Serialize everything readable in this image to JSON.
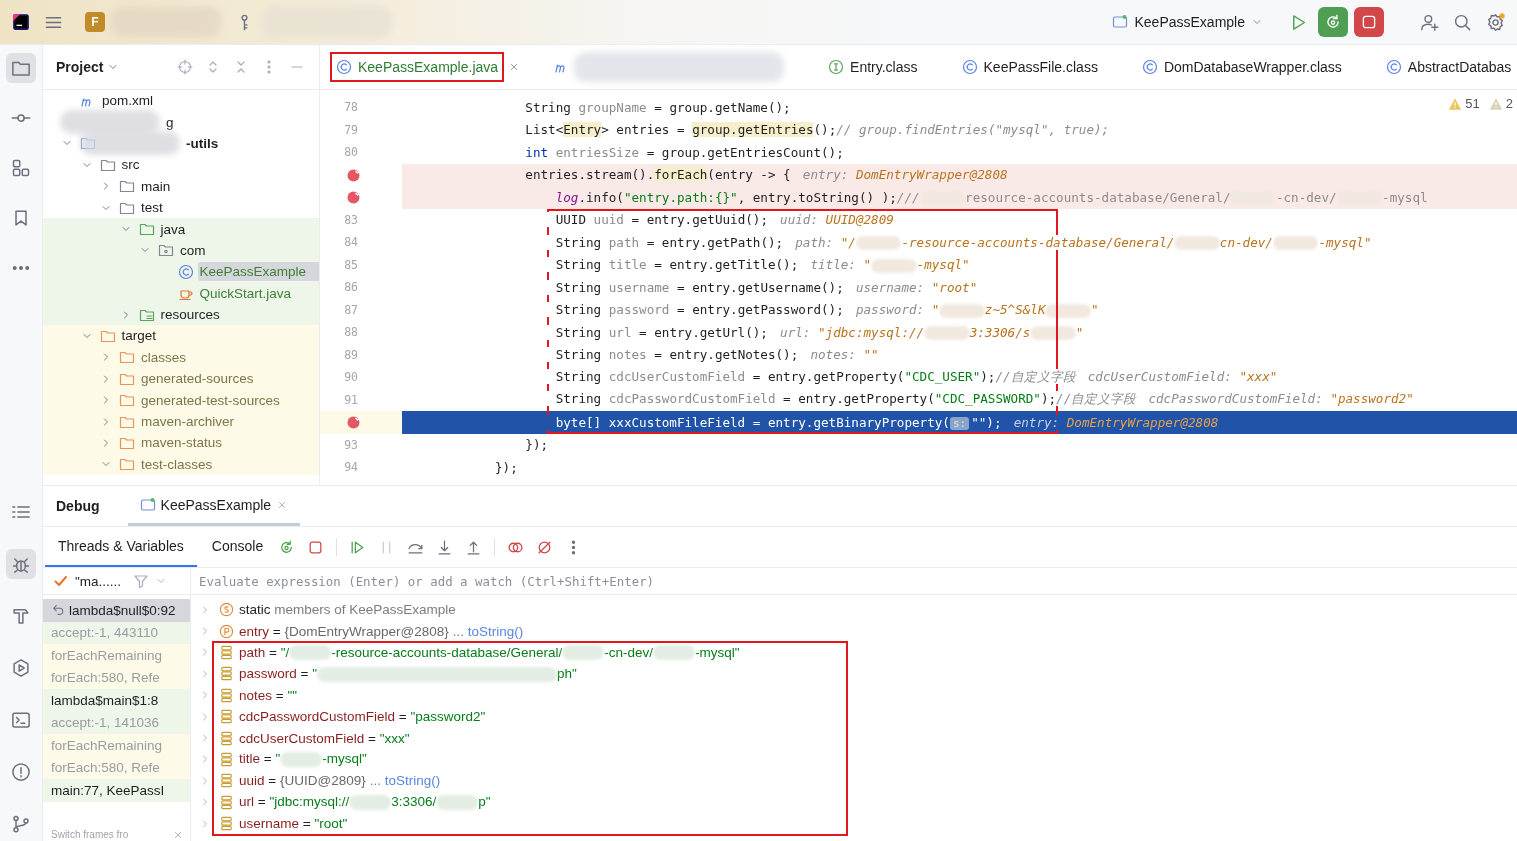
{
  "top_bar": {
    "project_badge": "F",
    "run_config": "KeePassExample"
  },
  "sidebar_top": [
    {
      "kind": "folder",
      "selected": true
    },
    {
      "kind": "commit",
      "selected": false
    },
    {
      "kind": "structure",
      "selected": false
    },
    {
      "kind": "bookmark",
      "selected": false
    },
    {
      "kind": "more",
      "selected": false
    }
  ],
  "sidebar_bottom": [
    {
      "kind": "list",
      "selected": false
    },
    {
      "kind": "debug",
      "selected": true
    },
    {
      "kind": "build",
      "selected": false
    },
    {
      "kind": "run",
      "selected": false
    },
    {
      "kind": "terminal",
      "selected": false
    },
    {
      "kind": "problems",
      "selected": false
    },
    {
      "kind": "git",
      "selected": false
    }
  ],
  "project": {
    "title": "Project",
    "tree": [
      {
        "name": "pom.xml",
        "kind": "maven-file",
        "selected": false
      },
      {
        "name": "g",
        "redacted": true,
        "selected": false
      },
      {
        "name": "-utils",
        "kind": "module",
        "redacted": true,
        "expanded": true,
        "selected": false,
        "children": [
          {
            "name": "src",
            "kind": "folder",
            "expanded": true,
            "selected": false,
            "children": [
              {
                "name": "main",
                "kind": "folder",
                "expanded": false,
                "selected": false
              },
              {
                "name": "test",
                "kind": "folder",
                "expanded": true,
                "selected": false,
                "children": [
                  {
                    "name": "java",
                    "kind": "source-folder",
                    "color": "#eef6ea",
                    "expanded": true,
                    "selected": false,
                    "children": [
                      {
                        "name": "com",
                        "kind": "package",
                        "color": "#eef6ea",
                        "expanded": true,
                        "selected": false,
                        "children": [
                          {
                            "name": "KeePassExample",
                            "kind": "test-class",
                            "color": "#eef6ea",
                            "selected": true
                          },
                          {
                            "name": "QuickStart.java",
                            "kind": "test-java-file",
                            "color": "#eef6ea",
                            "selected": false
                          }
                        ]
                      }
                    ]
                  },
                  {
                    "name": "resources",
                    "kind": "resources-folder",
                    "color": "#eef6ea",
                    "expanded": false,
                    "selected": false
                  }
                ]
              }
            ]
          },
          {
            "name": "target",
            "kind": "excluded-root",
            "color": "#fdfbe8",
            "expanded": true,
            "selected": false,
            "children": [
              {
                "name": "classes",
                "kind": "excluded-folder",
                "color": "#fdfbe8",
                "expanded": false,
                "selected": false
              },
              {
                "name": "generated-sources",
                "kind": "excluded-folder",
                "color": "#fdfbe8",
                "expanded": false,
                "selected": false
              },
              {
                "name": "generated-test-sources",
                "kind": "excluded-folder",
                "color": "#fdfbe8",
                "expanded": false,
                "selected": false
              },
              {
                "name": "maven-archiver",
                "kind": "excluded-folder",
                "color": "#fdfbe8",
                "expanded": false,
                "selected": false
              },
              {
                "name": "maven-status",
                "kind": "excluded-folder",
                "color": "#fdfbe8",
                "expanded": false,
                "selected": false
              },
              {
                "name": "test-classes",
                "kind": "excluded-folder",
                "color": "#fdfbe8",
                "expanded": true,
                "selected": false
              }
            ]
          }
        ]
      }
    ]
  },
  "editor": {
    "tabs": [
      {
        "label": "KeePassExample.java",
        "kind": "class",
        "selected": true,
        "marked": true
      },
      {
        "kind": "maven",
        "redacted": true,
        "selected": false,
        "marked": false
      },
      {
        "label": "Entry.class",
        "kind": "interface",
        "selected": false,
        "marked": false
      },
      {
        "label": "KeePassFile.class",
        "kind": "class",
        "selected": false,
        "marked": false
      },
      {
        "label": "DomDatabaseWrapper.class",
        "kind": "class",
        "selected": false,
        "marked": false
      },
      {
        "label": "AbstractDatabas",
        "kind": "class",
        "selected": false,
        "marked": false
      }
    ],
    "warnings": "51",
    "weak_warnings": "2",
    "blocks": [
      {
        "kind": "plain",
        "lines": [
          {
            "number": "78",
            "segs": [
              {
                "kind": "plain",
                "t": "                String "
              },
              {
                "kind": "unused",
                "t": "groupName"
              },
              {
                "kind": "plain",
                "t": " = group.getName();"
              }
            ]
          },
          {
            "number": "79",
            "segs": [
              {
                "kind": "plain",
                "t": "                List<"
              },
              {
                "kind": "highlight",
                "t": "Entry"
              },
              {
                "kind": "plain",
                "t": "> entries = "
              },
              {
                "kind": "highlight",
                "t": "group.getEntries"
              },
              {
                "kind": "plain",
                "t": "();"
              },
              {
                "kind": "comment",
                "t": "// group.findEntries(\"mysql\", true);"
              }
            ]
          },
          {
            "number": "80",
            "segs": [
              {
                "kind": "keyword",
                "t": "                int "
              },
              {
                "kind": "unused",
                "t": "entriesSize"
              },
              {
                "kind": "plain",
                "t": " = group.getEntriesCount();"
              }
            ]
          },
          {
            "breakpoint": true,
            "kind": "breakpoint-line",
            "segs": [
              {
                "kind": "plain",
                "t": "                entries.stream()."
              },
              {
                "kind": "highlight",
                "t": "forEach"
              },
              {
                "kind": "plain",
                "t": "(entry -> {"
              },
              {
                "kind": "hint",
                "t": "entry: "
              },
              {
                "kind": "value",
                "t": "DomEntryWrapper@2808"
              }
            ]
          },
          {
            "breakpoint": true,
            "kind": "breakpoint-line",
            "segs": [
              {
                "kind": "field",
                "t": "                    log"
              },
              {
                "kind": "plain",
                "t": ".info("
              },
              {
                "kind": "string",
                "t": "\"entry.path:{}\""
              },
              {
                "kind": "plain",
                "t": ", entry.toString() );"
              },
              {
                "kind": "comment",
                "t": "///"
              },
              {
                "kind": "redacted"
              },
              {
                "kind": "grey",
                "t": "resource-accounts-database/General/"
              },
              {
                "kind": "redacted"
              },
              {
                "kind": "grey",
                "t": "-cn-dev/"
              },
              {
                "kind": "redacted"
              },
              {
                "kind": "grey",
                "t": "-mysql"
              }
            ]
          }
        ]
      },
      {
        "kind": "annotated",
        "lines": [
          {
            "number": "83",
            "segs": [
              {
                "kind": "plain",
                "t": "                    UUID "
              },
              {
                "kind": "unused",
                "t": "uuid"
              },
              {
                "kind": "plain",
                "t": " = entry.getUuid();"
              },
              {
                "kind": "hint",
                "t": "uuid: "
              },
              {
                "kind": "value",
                "t": "UUID@2809"
              }
            ]
          },
          {
            "number": "84",
            "segs": [
              {
                "kind": "plain",
                "t": "                    String "
              },
              {
                "kind": "unused",
                "t": "path"
              },
              {
                "kind": "plain",
                "t": " = entry.getPath();"
              },
              {
                "kind": "hint",
                "t": "path: "
              },
              {
                "kind": "value",
                "t": "\"/"
              },
              {
                "kind": "redacted"
              },
              {
                "kind": "value",
                "t": "-resource-accounts-database/General/"
              },
              {
                "kind": "redacted"
              },
              {
                "kind": "value",
                "t": "cn-dev/"
              },
              {
                "kind": "redacted"
              },
              {
                "kind": "value",
                "t": "-mysql\""
              }
            ]
          },
          {
            "number": "85",
            "segs": [
              {
                "kind": "plain",
                "t": "                    String "
              },
              {
                "kind": "unused",
                "t": "title"
              },
              {
                "kind": "plain",
                "t": " = entry.getTitle();"
              },
              {
                "kind": "hint",
                "t": "title: "
              },
              {
                "kind": "value",
                "t": "\""
              },
              {
                "kind": "redacted"
              },
              {
                "kind": "value",
                "t": "-mysql\""
              }
            ]
          },
          {
            "number": "86",
            "segs": [
              {
                "kind": "plain",
                "t": "                    String "
              },
              {
                "kind": "unused",
                "t": "username"
              },
              {
                "kind": "plain",
                "t": " = entry.getUsername();"
              },
              {
                "kind": "hint",
                "t": "username: "
              },
              {
                "kind": "value",
                "t": "\"root\""
              }
            ]
          },
          {
            "number": "87",
            "segs": [
              {
                "kind": "plain",
                "t": "                    String "
              },
              {
                "kind": "unused",
                "t": "password"
              },
              {
                "kind": "plain",
                "t": " = entry.getPassword();"
              },
              {
                "kind": "hint",
                "t": "password: "
              },
              {
                "kind": "value",
                "t": "\""
              },
              {
                "kind": "redacted"
              },
              {
                "kind": "value",
                "t": "z~5^S&lK"
              },
              {
                "kind": "redacted"
              },
              {
                "kind": "value",
                "t": "\""
              }
            ]
          },
          {
            "number": "88",
            "segs": [
              {
                "kind": "plain",
                "t": "                    String "
              },
              {
                "kind": "unused",
                "t": "url"
              },
              {
                "kind": "plain",
                "t": " = entry.getUrl();"
              },
              {
                "kind": "hint",
                "t": "url: "
              },
              {
                "kind": "value",
                "t": "\"jdbc:mysql://"
              },
              {
                "kind": "redacted"
              },
              {
                "kind": "value",
                "t": "3:3306/s"
              },
              {
                "kind": "redacted"
              },
              {
                "kind": "value",
                "t": "\""
              }
            ]
          },
          {
            "number": "89",
            "segs": [
              {
                "kind": "plain",
                "t": "                    String "
              },
              {
                "kind": "unused",
                "t": "notes"
              },
              {
                "kind": "plain",
                "t": " = entry.getNotes();"
              },
              {
                "kind": "hint",
                "t": "notes: "
              },
              {
                "kind": "value",
                "t": "\"\""
              }
            ]
          },
          {
            "number": "90",
            "segs": [
              {
                "kind": "plain",
                "t": "                    String "
              },
              {
                "kind": "unused",
                "t": "cdcUserCustomField"
              },
              {
                "kind": "plain",
                "t": " = entry.getProperty("
              },
              {
                "kind": "string",
                "t": "\"CDC_USER\""
              },
              {
                "kind": "plain",
                "t": ");"
              },
              {
                "kind": "comment",
                "t": "//自定义字段"
              },
              {
                "kind": "hint",
                "t": "cdcUserCustomField: "
              },
              {
                "kind": "value",
                "t": "\"xxx\""
              }
            ]
          },
          {
            "number": "91",
            "segs": [
              {
                "kind": "plain",
                "t": "                    String "
              },
              {
                "kind": "unused",
                "t": "cdcPasswordCustomField"
              },
              {
                "kind": "plain",
                "t": " = entry.getProperty("
              },
              {
                "kind": "string",
                "t": "\"CDC_PASSWORD\""
              },
              {
                "kind": "plain",
                "t": ");"
              },
              {
                "kind": "comment",
                "t": "//自定义字段"
              },
              {
                "kind": "hint",
                "t": "cdcPasswordCustomField: "
              },
              {
                "kind": "value",
                "t": "\"password2\""
              }
            ]
          },
          {
            "breakpoint": true,
            "kind": "execution-line",
            "segs": [
              {
                "kind": "plain",
                "t": "                    byte[] xxxCustomFileField = entry.getBinaryProperty("
              },
              {
                "kind": "param-hint",
                "t": "s:"
              },
              {
                "kind": "plain",
                "t": "\"\");"
              },
              {
                "kind": "hint",
                "t": "entry: "
              },
              {
                "kind": "value",
                "t": "DomEntryWrapper@2808"
              }
            ]
          }
        ]
      },
      {
        "kind": "plain",
        "lines": [
          {
            "number": "93",
            "segs": [
              {
                "kind": "plain",
                "t": "                });"
              }
            ]
          },
          {
            "number": "94",
            "segs": [
              {
                "kind": "plain",
                "t": "            });"
              }
            ]
          }
        ]
      }
    ]
  },
  "debug": {
    "title": "Debug",
    "session": "KeePassExample",
    "tabs": [
      {
        "label": "Threads & Variables",
        "selected": true
      },
      {
        "label": "Console",
        "selected": false
      }
    ],
    "toolbar": [
      {
        "kind": "rerun",
        "disabled": false
      },
      {
        "kind": "stop",
        "disabled": false
      },
      {
        "kind": "resume",
        "disabled": false
      },
      {
        "kind": "pause",
        "disabled": true
      },
      {
        "kind": "step-over",
        "disabled": false
      },
      {
        "kind": "step-into",
        "disabled": false
      },
      {
        "kind": "step-out",
        "disabled": false
      },
      {
        "kind": "view-breakpoints",
        "disabled": false
      },
      {
        "kind": "mute-breakpoints",
        "disabled": false
      },
      {
        "kind": "more",
        "disabled": false
      }
    ],
    "thread": "\"ma......",
    "frames": [
      {
        "text": "lambda$null$0:92",
        "selected": true,
        "dim": false
      },
      {
        "text": "accept:-1, 443110",
        "selected": false,
        "dim": true,
        "color": "#eef6ea"
      },
      {
        "text": "forEachRemaining",
        "selected": false,
        "dim": true,
        "color": "#fdfbe8"
      },
      {
        "text": "forEach:580, Refe",
        "selected": false,
        "dim": true,
        "color": "#fdfbe8"
      },
      {
        "text": "lambda$main$1:8",
        "selected": false,
        "dim": false,
        "color": "#eef6ea"
      },
      {
        "text": "accept:-1, 141036",
        "selected": false,
        "dim": true,
        "color": "#eef6ea"
      },
      {
        "text": "forEachRemaining",
        "selected": false,
        "dim": true,
        "color": "#fdfbe8"
      },
      {
        "text": "forEach:580, Refe",
        "selected": false,
        "dim": true,
        "color": "#fdfbe8"
      },
      {
        "text": "main:77, KeePassI",
        "selected": false,
        "dim": false,
        "color": "#eef6ea"
      }
    ],
    "switch_hint": "Switch frames fro",
    "evaluate": {
      "placeholder": "Evaluate expression (Enter) or add a watch (Ctrl+Shift+Enter)"
    },
    "variable_groups": [
      {
        "kind": "plain",
        "variables": [
          {
            "kind": "static",
            "name": "static",
            "value": [
              {
                "kind": "muted",
                "t": " members of KeePassExample"
              }
            ]
          },
          {
            "kind": "param",
            "name": "entry",
            "value": [
              {
                "kind": "plain",
                "t": " = "
              },
              {
                "kind": "object",
                "t": "{DomEntryWrapper@2808}"
              }
            ],
            "link": "... toString()"
          }
        ]
      },
      {
        "kind": "annotated",
        "variables": [
          {
            "kind": "field",
            "name": "path",
            "value": [
              {
                "kind": "plain",
                "t": " = "
              },
              {
                "kind": "string",
                "t": "\"/"
              },
              {
                "kind": "redacted"
              },
              {
                "kind": "string",
                "t": "-resource-accounts-database/General/"
              },
              {
                "kind": "redacted"
              },
              {
                "kind": "string",
                "t": "-cn-dev/"
              },
              {
                "kind": "redacted"
              },
              {
                "kind": "string",
                "t": "-mysql\""
              }
            ]
          },
          {
            "kind": "field",
            "name": "password",
            "value": [
              {
                "kind": "plain",
                "t": " = "
              },
              {
                "kind": "string",
                "t": "\""
              },
              {
                "kind": "redacted-long"
              },
              {
                "kind": "string",
                "t": "ph\""
              }
            ]
          },
          {
            "kind": "field",
            "name": "notes",
            "value": [
              {
                "kind": "plain",
                "t": " = "
              },
              {
                "kind": "string",
                "t": "\"\""
              }
            ]
          },
          {
            "kind": "field",
            "name": "cdcPasswordCustomField",
            "value": [
              {
                "kind": "plain",
                "t": " = "
              },
              {
                "kind": "string",
                "t": "\"password2\""
              }
            ]
          },
          {
            "kind": "field",
            "name": "cdcUserCustomField",
            "value": [
              {
                "kind": "plain",
                "t": " = "
              },
              {
                "kind": "string",
                "t": "\"xxx\""
              }
            ]
          },
          {
            "kind": "field",
            "name": "title",
            "value": [
              {
                "kind": "plain",
                "t": " = "
              },
              {
                "kind": "string",
                "t": "\""
              },
              {
                "kind": "redacted"
              },
              {
                "kind": "string",
                "t": "-mysql\""
              }
            ]
          },
          {
            "kind": "field",
            "name": "uuid",
            "value": [
              {
                "kind": "plain",
                "t": " = "
              },
              {
                "kind": "object",
                "t": "{UUID@2809}"
              }
            ],
            "link": "... toString()"
          },
          {
            "kind": "field",
            "name": "url",
            "value": [
              {
                "kind": "plain",
                "t": " = "
              },
              {
                "kind": "string",
                "t": "\"jdbc:mysql://"
              },
              {
                "kind": "redacted"
              },
              {
                "kind": "string",
                "t": "3:3306/"
              },
              {
                "kind": "redacted"
              },
              {
                "kind": "string",
                "t": "p\""
              }
            ]
          },
          {
            "kind": "field",
            "name": "username",
            "value": [
              {
                "kind": "plain",
                "t": " = "
              },
              {
                "kind": "string",
                "t": "\"root\""
              }
            ]
          }
        ]
      }
    ]
  }
}
